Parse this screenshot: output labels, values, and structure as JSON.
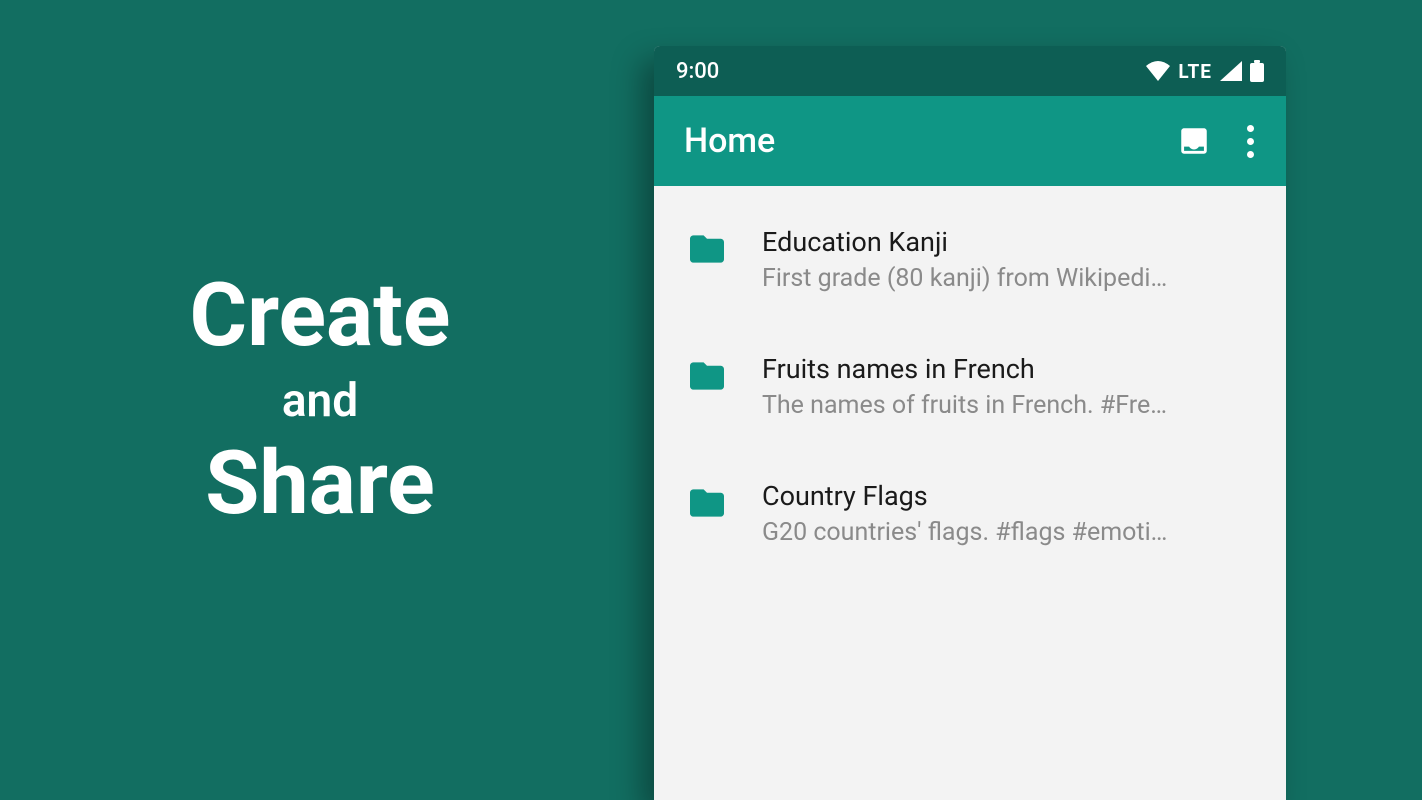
{
  "hero": {
    "line1": "Create",
    "line2": "and",
    "line3": "Share"
  },
  "statusbar": {
    "time": "9:00",
    "network_label": "LTE"
  },
  "appbar": {
    "title": "Home"
  },
  "list": {
    "items": [
      {
        "title": "Education Kanji",
        "subtitle": "First grade (80 kanji) from Wikipedi…"
      },
      {
        "title": "Fruits names in French",
        "subtitle": "The names of fruits in French. #Fre…"
      },
      {
        "title": "Country Flags",
        "subtitle": "G20 countries' flags. #flags #emoti…"
      }
    ]
  }
}
